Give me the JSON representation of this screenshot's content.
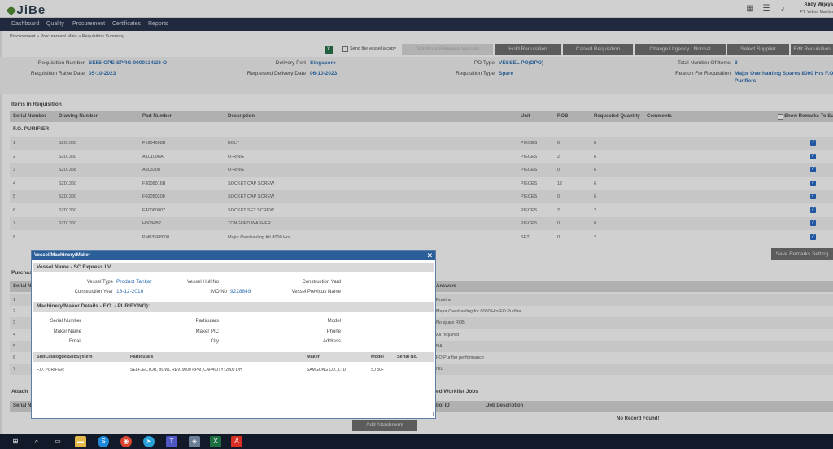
{
  "app": {
    "logo": "JiBe",
    "user_name": "Andy Wijaya",
    "user_org": "PT. Vektor Maritim"
  },
  "nav": [
    "Dashboard",
    "Quality",
    "Procurement",
    "Certificates",
    "Reports"
  ],
  "breadcrumb": "Procurement » Procurement Main » Requisition Summary",
  "toolbar": {
    "send_copy_label": "Send the vessel a copy",
    "buttons": [
      "Distribute Between Vessels",
      "Hold Requisition",
      "Cancel Requisition",
      "Change Urgency : Normal",
      "Select Supplier",
      "Edit Requisition"
    ]
  },
  "summary": {
    "req_number_label": "Requisition Number",
    "req_number": "SE55-OPE-SPRG-0000134/23-O",
    "raise_date_label": "Requisition Raise Date",
    "raise_date": "05-10-2023",
    "delivery_port_label": "Delivery Port",
    "delivery_port": "Singapore",
    "req_delivery_label": "Requested Delivery Date",
    "req_delivery": "06-10-2023",
    "po_type_label": "PO Type",
    "po_type": "VESSEL PO(DPO)",
    "req_type_label": "Requisition Type",
    "req_type": "Spare",
    "total_items_label": "Total Number Of Items",
    "total_items": "8",
    "reason_label": "Reason For Requisition",
    "reason_line1": "Major Overhauling Spares 8000 Hrs F.O.",
    "reason_line2": "Purifiers"
  },
  "items": {
    "section_title": "Items In Requisition",
    "columns": [
      "Serial Number",
      "Drawing Number",
      "Part Number",
      "Description",
      "Unit",
      "ROB",
      "Requested Quantity",
      "Comments"
    ],
    "show_remarks_label": "Show Remarks To Supplier",
    "group": "F.O. PURIFIER",
    "rows": [
      [
        "1",
        "S201360",
        "F1604008B",
        "BOLT",
        "PIECES",
        "0",
        "8"
      ],
      [
        "2",
        "S201360",
        "A101096A",
        "O-RING",
        "PIECES",
        "2",
        "6"
      ],
      [
        "3",
        "S201358",
        "A803308",
        "O-RING",
        "PIECES",
        "0",
        "6"
      ],
      [
        "4",
        "S201360",
        "F3008016B",
        "SOCKET CAP SCREW",
        "PIECES",
        "12",
        "6"
      ],
      [
        "5",
        "S201360",
        "F60050208",
        "SOCKET CAP SCREW",
        "PIECES",
        "0",
        "6"
      ],
      [
        "6",
        "S201360",
        "E40060807",
        "SOCKET SET SCREW",
        "PIECES",
        "2",
        "2"
      ],
      [
        "7",
        "S201360",
        "H5084B2",
        "TONGUED WASHER",
        "PIECES",
        "0",
        "8"
      ],
      [
        "8",
        "",
        "PM035F8000",
        "Major Overhauling Kit 8000 Hrs",
        "SET",
        "0",
        "2"
      ]
    ],
    "save_remarks": "Save Remarks Setting"
  },
  "background": {
    "purchase_label": "Purchase",
    "serial_col": "Serial N",
    "answers_col": "Answers",
    "answers": [
      "Routine",
      "Major Overhauling for 8000 Hrs FO Purifier",
      "No spare ROB",
      "As required",
      "NA",
      "FO Purifier performance",
      "NIL"
    ],
    "serial_nums": [
      "1",
      "2",
      "3",
      "4",
      "5",
      "6",
      "7"
    ],
    "attach_label": "Attach",
    "serial_col2": "Serial N",
    "worklist_label": "ed Worklist Jobs",
    "job_id_col": "bol ID",
    "job_desc_col": "Job Description",
    "no_record": "No Record Found!",
    "add_attachment": "Add Attachment"
  },
  "modal": {
    "title": "Vessel/Machinery/Maker",
    "vessel_name": "Vessel Name - SC Express LV",
    "vessel_type_label": "Vessel Type",
    "vessel_type": "Product Tanker",
    "hull_label": "Vessel Hull No",
    "hull": "",
    "yard_label": "Construction Yard",
    "yard": "",
    "year_label": "Construction Year",
    "year": "16-12-2016",
    "imo_label": "IMO No",
    "imo": "9228849",
    "prev_name_label": "Vessel Previous Name",
    "prev_name": "",
    "machinery_band": "Machinery/Maker Details - F.O. - PURIFYING):",
    "serial_label": "Serial Number",
    "particulars_label": "Particulars",
    "model_label": "Model",
    "maker_name_label": "Maker Name",
    "maker_pic_label": "Maker PIC",
    "phone_label": "Phone",
    "email_label": "Email",
    "city_label": "City",
    "address_label": "Address",
    "table_cols": [
      "SubCatalogue/SubSystem",
      "Particulars",
      "Maker",
      "Model",
      "Serial No."
    ],
    "table_row": [
      "F.O. PURIFIER",
      "SELFJECTOR, BOWL REV. 9000 RPM, CAPACITY: 2000 L/H",
      "SAMGONG CO., LTD",
      "SJ 30F",
      ""
    ]
  },
  "taskbar_icons": [
    "windows-icon",
    "search-icon",
    "task-view-icon",
    "file-explorer-icon",
    "skype-icon",
    "chrome-icon",
    "telegram-icon",
    "teams-icon",
    "app-icon",
    "excel-icon",
    "pdf-icon"
  ]
}
